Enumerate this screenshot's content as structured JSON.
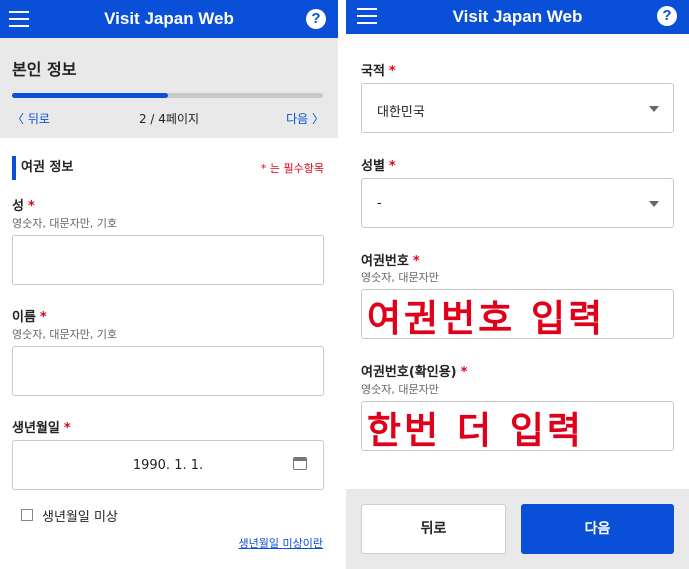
{
  "app": {
    "title": "Visit Japan Web"
  },
  "left": {
    "section_title": "본인 정보",
    "progress": {
      "fraction": 0.5
    },
    "nav": {
      "back": "〈 뒤로",
      "page": "2 / 4페이지",
      "next": "다음 〉"
    },
    "subsection": "여권 정보",
    "required_note": "* 는 필수항목",
    "fields": {
      "surname": {
        "label": "성",
        "hint": "영숫자, 대문자만, 기호",
        "value": ""
      },
      "given_name": {
        "label": "이름",
        "hint": "영숫자, 대문자만, 기호",
        "value": ""
      },
      "birthdate": {
        "label": "생년월일",
        "value": "1990. 1. 1."
      }
    },
    "unknown_birthdate_checkbox": "생년월일 미상",
    "unknown_birthdate_link": "생년월일 미상이란"
  },
  "right": {
    "fields": {
      "nationality": {
        "label": "국적",
        "value": "대한민국"
      },
      "gender": {
        "label": "성별",
        "value": "-"
      },
      "passport_number": {
        "label": "여권번호",
        "hint": "영숫자, 대문자만",
        "overlay": "여권번호 입력"
      },
      "passport_confirm": {
        "label": "여권번호(확인용)",
        "hint": "영숫자, 대문자만",
        "overlay": "한번 더 입력"
      }
    },
    "buttons": {
      "back": "뒤로",
      "next": "다음"
    }
  },
  "required_star": "*",
  "colors": {
    "brand": "#0a4fd8",
    "required": "#e0001a",
    "overlay_text": "#e0001a"
  },
  "icons": {
    "menu": "hamburger-icon",
    "help": "question-icon",
    "calendar": "calendar-icon",
    "dropdown": "caret-down-icon"
  }
}
